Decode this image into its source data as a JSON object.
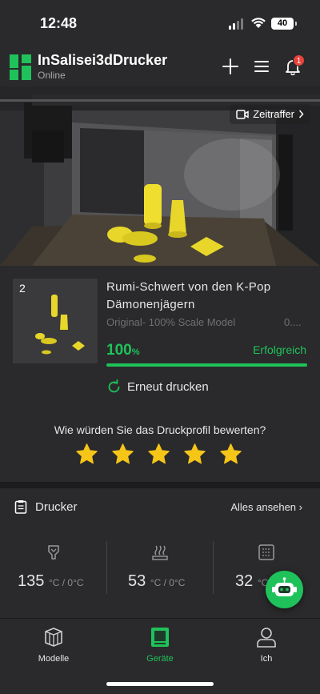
{
  "status_bar": {
    "time": "12:48",
    "battery": "40"
  },
  "header": {
    "printer_name": "InSalisei3dDrucker",
    "printer_status": "Online",
    "notification_count": "1"
  },
  "camera": {
    "timelapse_label": "Zeitraffer"
  },
  "print_job": {
    "plate_number": "2",
    "model_title": "Rumi-Schwert von den K-Pop Dämonenjägern",
    "model_subtitle": "Original- 100% Scale Model",
    "model_subtitle_more": "0....",
    "progress_value": "100",
    "progress_unit": "%",
    "progress_fraction": 1.0,
    "status_text": "Erfolgreich",
    "reprint_label": "Erneut drucken",
    "accent_color": "#1fc25a"
  },
  "rating": {
    "question": "Wie würden Sie das Druckprofil bewerten?",
    "stars": 5,
    "star_color": "#f5c518"
  },
  "printer_section": {
    "title": "Drucker",
    "see_all": "Alles ansehen",
    "temps": [
      {
        "value": "135",
        "unit": "°C / 0°C",
        "icon": "nozzle-icon"
      },
      {
        "value": "53",
        "unit": "°C / 0°C",
        "icon": "heatbed-icon"
      },
      {
        "value": "32",
        "unit": "°C",
        "icon": "chamber-icon"
      }
    ]
  },
  "tabs": [
    {
      "label": "Modelle",
      "icon": "cube-icon",
      "active": false
    },
    {
      "label": "Geräte",
      "icon": "printer-icon",
      "active": true
    },
    {
      "label": "Ich",
      "icon": "person-icon",
      "active": false
    }
  ]
}
